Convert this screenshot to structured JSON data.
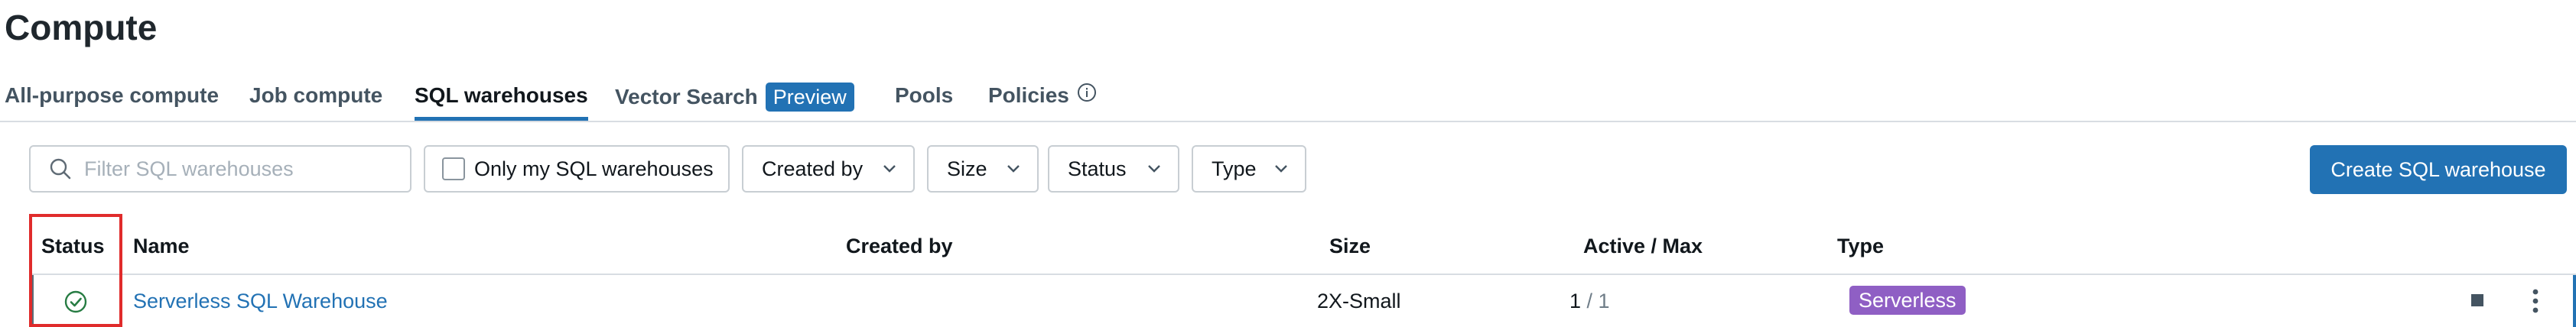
{
  "page": {
    "title": "Compute"
  },
  "tabs": [
    {
      "label": "All-purpose compute"
    },
    {
      "label": "Job compute"
    },
    {
      "label": "SQL warehouses",
      "active": true
    },
    {
      "label": "Vector Search",
      "badge": "Preview"
    },
    {
      "label": "Pools"
    },
    {
      "label": "Policies"
    }
  ],
  "filters": {
    "search_placeholder": "Filter SQL warehouses",
    "search_value": "",
    "only_mine_label": "Only my SQL warehouses",
    "only_mine_checked": false,
    "created_by_label": "Created by",
    "size_label": "Size",
    "status_label": "Status",
    "type_label": "Type",
    "create_button_label": "Create SQL warehouse"
  },
  "table": {
    "columns": {
      "status": "Status",
      "name": "Name",
      "created_by": "Created by",
      "size": "Size",
      "active_max": "Active / Max",
      "type": "Type"
    },
    "rows": [
      {
        "status_icon": "check-circle-icon",
        "name": "Serverless SQL Warehouse",
        "created_by": "",
        "size": "2X-Small",
        "active": "1",
        "separator": " / ",
        "max": "1",
        "type": "Serverless"
      }
    ]
  },
  "colors": {
    "accent": "#2272b4",
    "serverless_badge": "#8f5fc4",
    "status_ok": "#277c43",
    "highlight_box": "#e02b2b"
  },
  "icons": {
    "search": "search-icon",
    "chevron": "chevron-down-icon",
    "info": "info-icon",
    "stop": "stop-icon",
    "more": "kebab-menu-icon"
  }
}
